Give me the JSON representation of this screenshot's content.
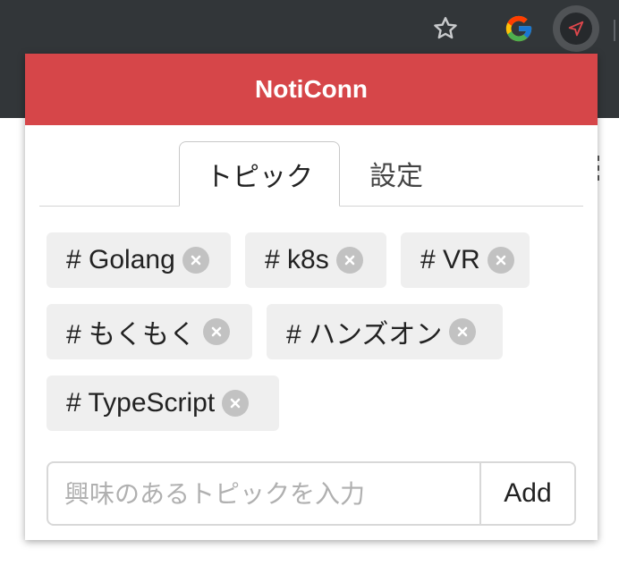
{
  "browser": {
    "toolbar_icons": [
      "star-icon",
      "google-icon",
      "extension-navigation-icon"
    ],
    "colors": {
      "toolbar": "#323639",
      "extension_accent": "#e0474c"
    }
  },
  "popup": {
    "title": "NotiConn",
    "header_color": "#d64649",
    "tabs": [
      {
        "label": "トピック",
        "active": true
      },
      {
        "label": "設定",
        "active": false
      }
    ],
    "topics": [
      {
        "label": "# Golang"
      },
      {
        "label": "# k8s"
      },
      {
        "label": "# VR"
      },
      {
        "label": "# もくもく"
      },
      {
        "label": "# ハンズオン"
      },
      {
        "label": "# TypeScript"
      }
    ],
    "input": {
      "placeholder": "興味のあるトピックを入力",
      "value": ""
    },
    "add_label": "Add"
  }
}
